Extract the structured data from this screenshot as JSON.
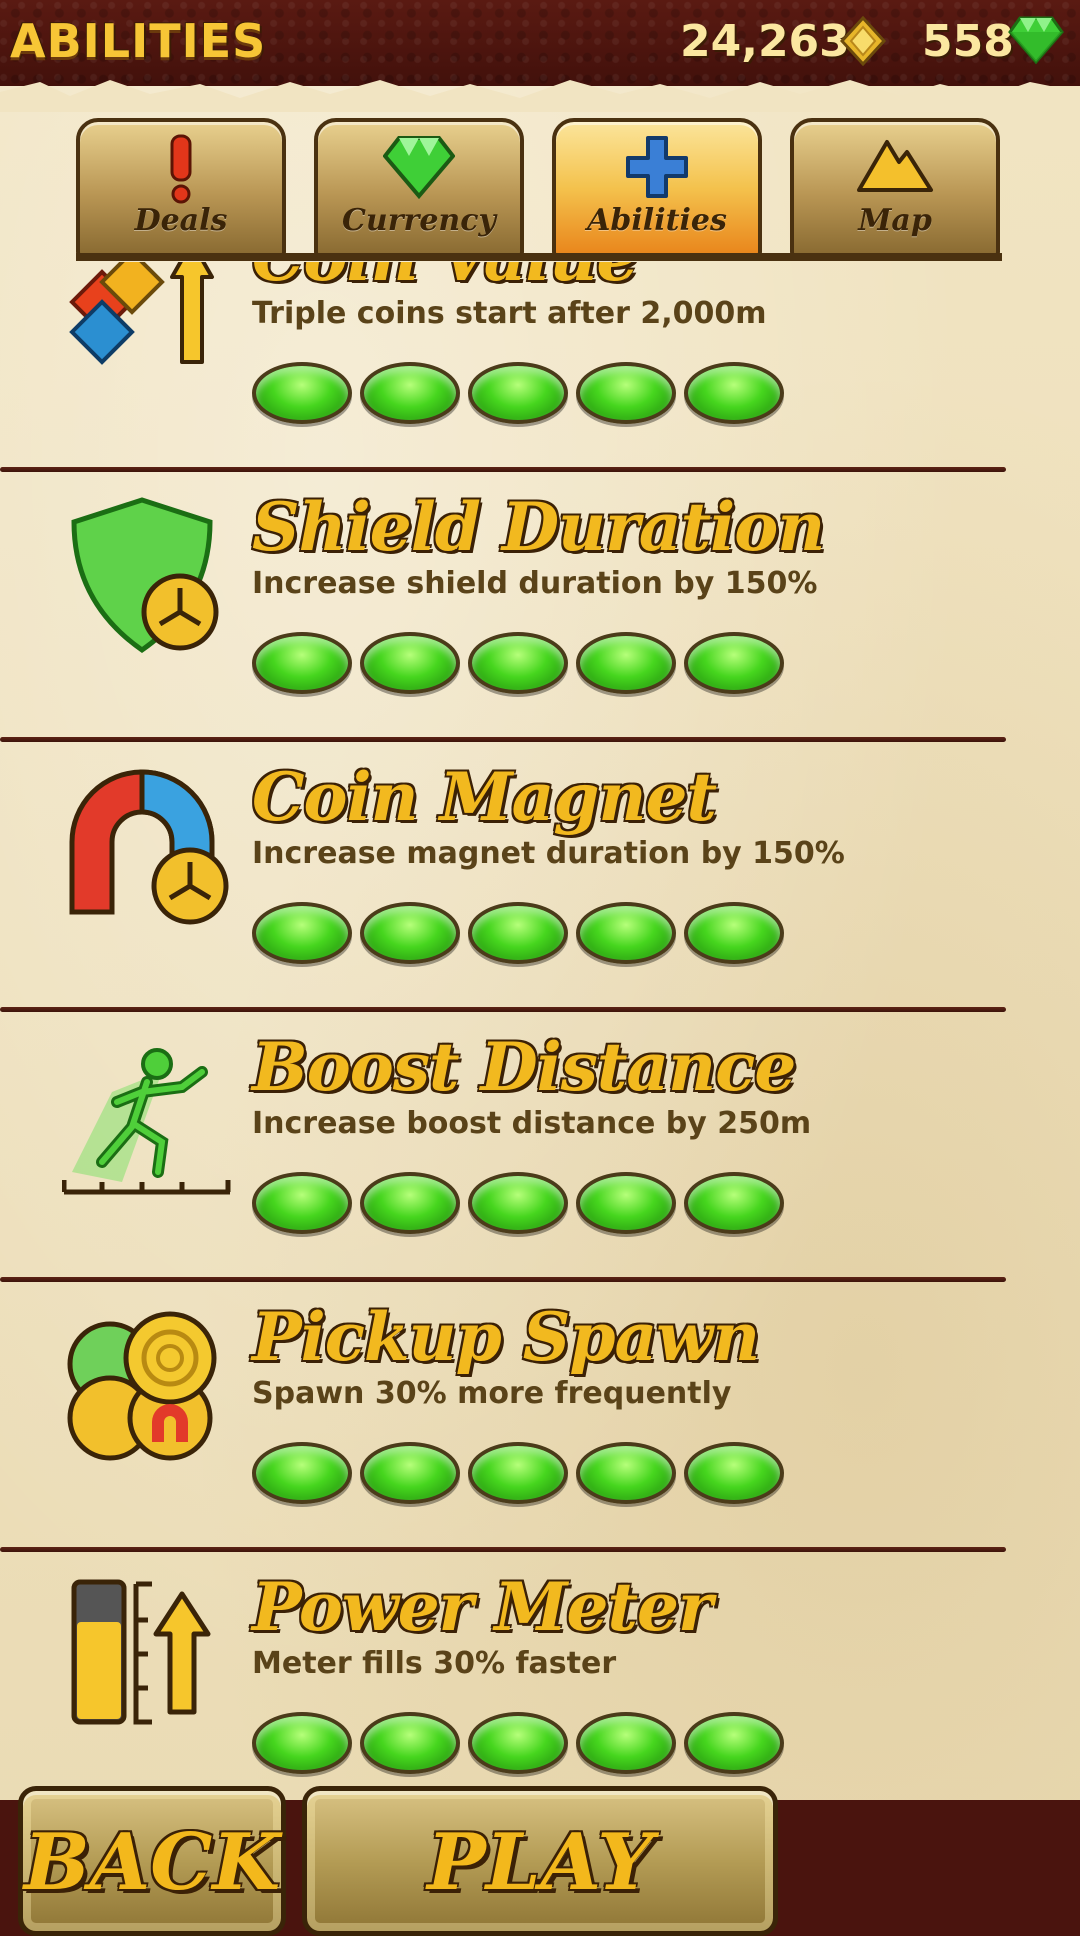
{
  "header": {
    "title": "ABILITIES",
    "coins": "24,263",
    "gems": "558",
    "coin_icon": "gold-coin-icon",
    "gem_icon": "green-gem-icon"
  },
  "tabs": [
    {
      "label": "Deals",
      "icon": "exclamation-icon",
      "active": false
    },
    {
      "label": "Currency",
      "icon": "gem-icon",
      "active": false
    },
    {
      "label": "Abilities",
      "icon": "plus-icon",
      "active": true
    },
    {
      "label": "Map",
      "icon": "mountain-icon",
      "active": false
    }
  ],
  "abilities": [
    {
      "title": "Coin Value",
      "description": "Triple coins start after 2,000m",
      "level": 5,
      "max_level": 5,
      "icon": "coin-value-icon"
    },
    {
      "title": "Shield Duration",
      "description": "Increase shield duration by 150%",
      "level": 5,
      "max_level": 5,
      "icon": "shield-timer-icon"
    },
    {
      "title": "Coin Magnet",
      "description": "Increase magnet duration by 150%",
      "level": 5,
      "max_level": 5,
      "icon": "magnet-timer-icon"
    },
    {
      "title": "Boost Distance",
      "description": "Increase boost distance by 250m",
      "level": 5,
      "max_level": 5,
      "icon": "running-man-icon"
    },
    {
      "title": "Pickup Spawn",
      "description": "Spawn 30% more frequently",
      "level": 5,
      "max_level": 5,
      "icon": "pickup-coins-icon"
    },
    {
      "title": "Power Meter",
      "description": "Meter fills 30% faster",
      "level": 5,
      "max_level": 5,
      "icon": "power-meter-icon"
    }
  ],
  "buttons": {
    "back": "BACK",
    "play": "PLAY"
  },
  "colors": {
    "title_gold": "#f2b91f",
    "pip_green": "#46d61e",
    "parchment": "#f1e4c2",
    "leather": "#4a140e"
  }
}
